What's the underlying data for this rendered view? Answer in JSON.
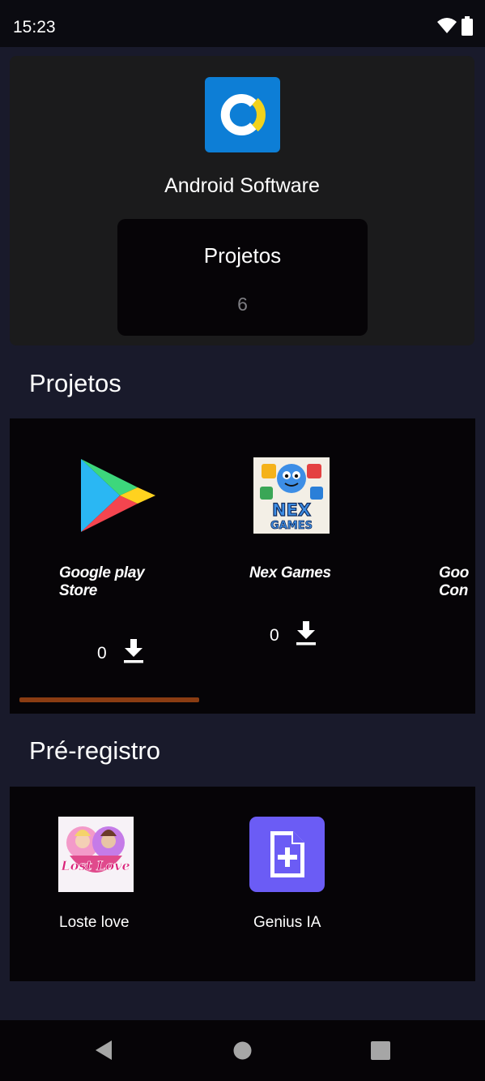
{
  "status_bar": {
    "time": "15:23",
    "icons": [
      "wifi-icon",
      "battery-icon"
    ]
  },
  "developer": {
    "name": "Android Software",
    "logo_icon": "android-software-logo",
    "logo_color": "#0d7ed6"
  },
  "stats": {
    "label": "Projetos",
    "value": "6"
  },
  "projects_section": {
    "title": "Projetos",
    "items": [
      {
        "name_line1": "Google play",
        "name_line2": "Store",
        "downloads": "0",
        "icon": "google-play-icon"
      },
      {
        "name_line1": "Nex Games",
        "name_line2": "",
        "downloads": "0",
        "icon": "nex-games-icon",
        "icon_text": [
          "NEX",
          "GAMES"
        ]
      },
      {
        "name_line1": "Goo",
        "name_line2": "Con",
        "icon": "partial-item"
      }
    ],
    "accent_color": "#8a3c12"
  },
  "preregistro_section": {
    "title": "Pré-registro",
    "items": [
      {
        "name": "Loste love",
        "icon": "lost-love-icon",
        "icon_text": "Lost Love"
      },
      {
        "name": "Genius IA",
        "icon": "document-plus-icon",
        "icon_color": "#6b5cf5"
      }
    ]
  },
  "nav_bar": {
    "buttons": [
      "back-icon",
      "home-icon",
      "recents-icon"
    ]
  }
}
